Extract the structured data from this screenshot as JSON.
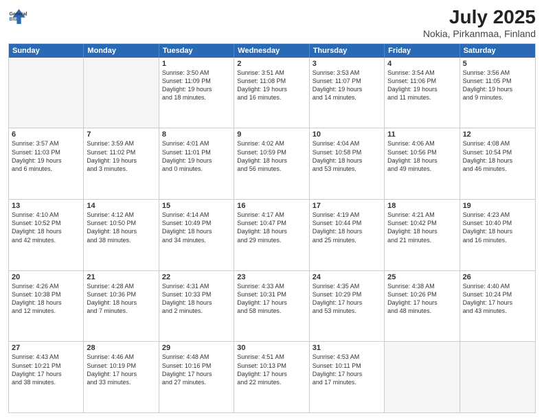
{
  "header": {
    "logo": {
      "line1": "General",
      "line2": "Blue"
    },
    "title": "July 2025",
    "subtitle": "Nokia, Pirkanmaa, Finland"
  },
  "days": [
    "Sunday",
    "Monday",
    "Tuesday",
    "Wednesday",
    "Thursday",
    "Friday",
    "Saturday"
  ],
  "rows": [
    [
      {
        "day": "",
        "content": "",
        "empty": true
      },
      {
        "day": "",
        "content": "",
        "empty": true
      },
      {
        "day": "1",
        "content": "Sunrise: 3:50 AM\nSunset: 11:09 PM\nDaylight: 19 hours\nand 18 minutes.",
        "empty": false
      },
      {
        "day": "2",
        "content": "Sunrise: 3:51 AM\nSunset: 11:08 PM\nDaylight: 19 hours\nand 16 minutes.",
        "empty": false
      },
      {
        "day": "3",
        "content": "Sunrise: 3:53 AM\nSunset: 11:07 PM\nDaylight: 19 hours\nand 14 minutes.",
        "empty": false
      },
      {
        "day": "4",
        "content": "Sunrise: 3:54 AM\nSunset: 11:06 PM\nDaylight: 19 hours\nand 11 minutes.",
        "empty": false
      },
      {
        "day": "5",
        "content": "Sunrise: 3:56 AM\nSunset: 11:05 PM\nDaylight: 19 hours\nand 9 minutes.",
        "empty": false
      }
    ],
    [
      {
        "day": "6",
        "content": "Sunrise: 3:57 AM\nSunset: 11:03 PM\nDaylight: 19 hours\nand 6 minutes.",
        "empty": false
      },
      {
        "day": "7",
        "content": "Sunrise: 3:59 AM\nSunset: 11:02 PM\nDaylight: 19 hours\nand 3 minutes.",
        "empty": false
      },
      {
        "day": "8",
        "content": "Sunrise: 4:01 AM\nSunset: 11:01 PM\nDaylight: 19 hours\nand 0 minutes.",
        "empty": false
      },
      {
        "day": "9",
        "content": "Sunrise: 4:02 AM\nSunset: 10:59 PM\nDaylight: 18 hours\nand 56 minutes.",
        "empty": false
      },
      {
        "day": "10",
        "content": "Sunrise: 4:04 AM\nSunset: 10:58 PM\nDaylight: 18 hours\nand 53 minutes.",
        "empty": false
      },
      {
        "day": "11",
        "content": "Sunrise: 4:06 AM\nSunset: 10:56 PM\nDaylight: 18 hours\nand 49 minutes.",
        "empty": false
      },
      {
        "day": "12",
        "content": "Sunrise: 4:08 AM\nSunset: 10:54 PM\nDaylight: 18 hours\nand 46 minutes.",
        "empty": false
      }
    ],
    [
      {
        "day": "13",
        "content": "Sunrise: 4:10 AM\nSunset: 10:52 PM\nDaylight: 18 hours\nand 42 minutes.",
        "empty": false
      },
      {
        "day": "14",
        "content": "Sunrise: 4:12 AM\nSunset: 10:50 PM\nDaylight: 18 hours\nand 38 minutes.",
        "empty": false
      },
      {
        "day": "15",
        "content": "Sunrise: 4:14 AM\nSunset: 10:49 PM\nDaylight: 18 hours\nand 34 minutes.",
        "empty": false
      },
      {
        "day": "16",
        "content": "Sunrise: 4:17 AM\nSunset: 10:47 PM\nDaylight: 18 hours\nand 29 minutes.",
        "empty": false
      },
      {
        "day": "17",
        "content": "Sunrise: 4:19 AM\nSunset: 10:44 PM\nDaylight: 18 hours\nand 25 minutes.",
        "empty": false
      },
      {
        "day": "18",
        "content": "Sunrise: 4:21 AM\nSunset: 10:42 PM\nDaylight: 18 hours\nand 21 minutes.",
        "empty": false
      },
      {
        "day": "19",
        "content": "Sunrise: 4:23 AM\nSunset: 10:40 PM\nDaylight: 18 hours\nand 16 minutes.",
        "empty": false
      }
    ],
    [
      {
        "day": "20",
        "content": "Sunrise: 4:26 AM\nSunset: 10:38 PM\nDaylight: 18 hours\nand 12 minutes.",
        "empty": false
      },
      {
        "day": "21",
        "content": "Sunrise: 4:28 AM\nSunset: 10:36 PM\nDaylight: 18 hours\nand 7 minutes.",
        "empty": false
      },
      {
        "day": "22",
        "content": "Sunrise: 4:31 AM\nSunset: 10:33 PM\nDaylight: 18 hours\nand 2 minutes.",
        "empty": false
      },
      {
        "day": "23",
        "content": "Sunrise: 4:33 AM\nSunset: 10:31 PM\nDaylight: 17 hours\nand 58 minutes.",
        "empty": false
      },
      {
        "day": "24",
        "content": "Sunrise: 4:35 AM\nSunset: 10:29 PM\nDaylight: 17 hours\nand 53 minutes.",
        "empty": false
      },
      {
        "day": "25",
        "content": "Sunrise: 4:38 AM\nSunset: 10:26 PM\nDaylight: 17 hours\nand 48 minutes.",
        "empty": false
      },
      {
        "day": "26",
        "content": "Sunrise: 4:40 AM\nSunset: 10:24 PM\nDaylight: 17 hours\nand 43 minutes.",
        "empty": false
      }
    ],
    [
      {
        "day": "27",
        "content": "Sunrise: 4:43 AM\nSunset: 10:21 PM\nDaylight: 17 hours\nand 38 minutes.",
        "empty": false
      },
      {
        "day": "28",
        "content": "Sunrise: 4:46 AM\nSunset: 10:19 PM\nDaylight: 17 hours\nand 33 minutes.",
        "empty": false
      },
      {
        "day": "29",
        "content": "Sunrise: 4:48 AM\nSunset: 10:16 PM\nDaylight: 17 hours\nand 27 minutes.",
        "empty": false
      },
      {
        "day": "30",
        "content": "Sunrise: 4:51 AM\nSunset: 10:13 PM\nDaylight: 17 hours\nand 22 minutes.",
        "empty": false
      },
      {
        "day": "31",
        "content": "Sunrise: 4:53 AM\nSunset: 10:11 PM\nDaylight: 17 hours\nand 17 minutes.",
        "empty": false
      },
      {
        "day": "",
        "content": "",
        "empty": true
      },
      {
        "day": "",
        "content": "",
        "empty": true
      }
    ]
  ]
}
